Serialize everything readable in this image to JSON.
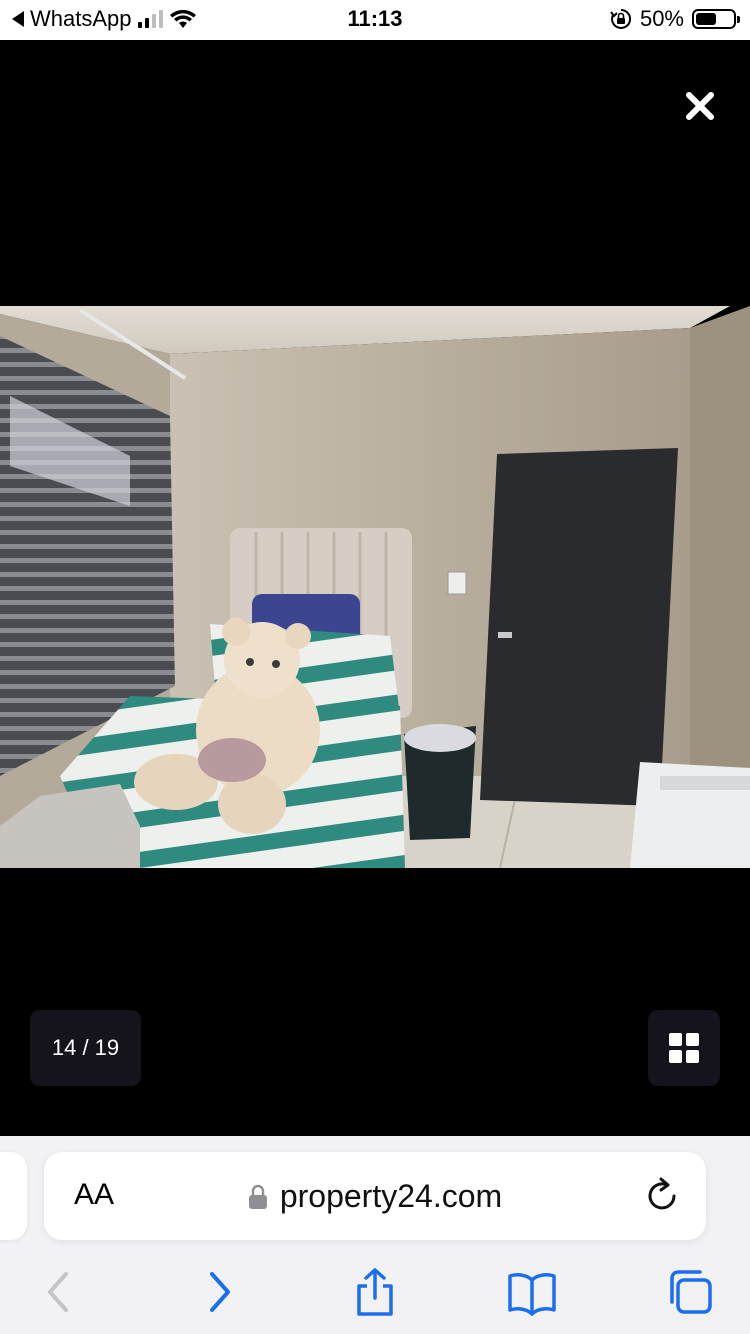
{
  "status_bar": {
    "back_app": "WhatsApp",
    "time": "11:13",
    "battery": "50%",
    "icons": [
      "back-triangle-icon",
      "signal-icon",
      "wifi-icon",
      "orientation-lock-icon",
      "battery-icon"
    ]
  },
  "viewer": {
    "counter": "14 / 19",
    "icons": [
      "close-icon",
      "grid-icon"
    ]
  },
  "browser": {
    "text_size": "AA",
    "domain": "property24.com",
    "icons": [
      "lock-icon",
      "reload-icon",
      "back-chevron-icon",
      "forward-chevron-icon",
      "share-icon",
      "bookmarks-icon",
      "tabs-icon"
    ],
    "accent": "#1a6ef0"
  }
}
